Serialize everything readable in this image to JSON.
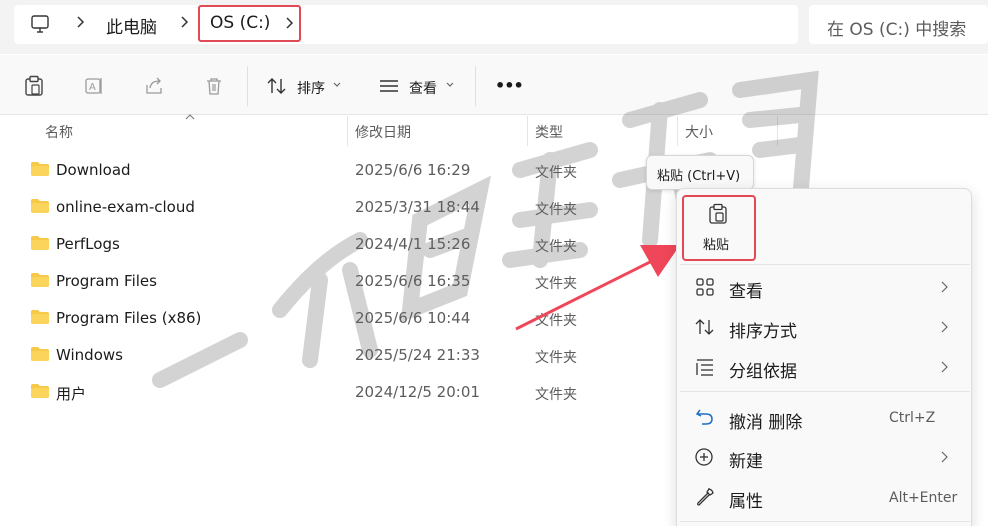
{
  "address": {
    "root_label": "此电脑",
    "drive_label": "OS (C:)",
    "search_placeholder": "在 OS (C:) 中搜索"
  },
  "toolbar": {
    "sort_label": "排序",
    "view_label": "查看",
    "more_label": "•••"
  },
  "columns": {
    "name": "名称",
    "date": "修改日期",
    "type": "类型",
    "size": "大小"
  },
  "files": [
    {
      "name": "Download",
      "date": "2025/6/6 16:29",
      "type": "文件夹"
    },
    {
      "name": "online-exam-cloud",
      "date": "2025/3/31 18:44",
      "type": "文件夹"
    },
    {
      "name": "PerfLogs",
      "date": "2024/4/1 15:26",
      "type": "文件夹"
    },
    {
      "name": "Program Files",
      "date": "2025/6/6 16:35",
      "type": "文件夹"
    },
    {
      "name": "Program Files (x86)",
      "date": "2025/6/6 10:44",
      "type": "文件夹"
    },
    {
      "name": "Windows",
      "date": "2025/5/24 21:33",
      "type": "文件夹"
    },
    {
      "name": "用户",
      "date": "2024/12/5 20:01",
      "type": "文件夹"
    }
  ],
  "tooltip": "粘贴 (Ctrl+V)",
  "menu": {
    "paste": "粘贴",
    "view": "查看",
    "sort": "排序方式",
    "group": "分组依据",
    "undo": "撤消 删除",
    "undo_shortcut": "Ctrl+Z",
    "new": "新建",
    "properties": "属性",
    "properties_shortcut": "Alt+Enter"
  },
  "colors": {
    "highlight_border": "#e04a55",
    "arrow": "#f0465a",
    "folder": "#f7c948"
  }
}
